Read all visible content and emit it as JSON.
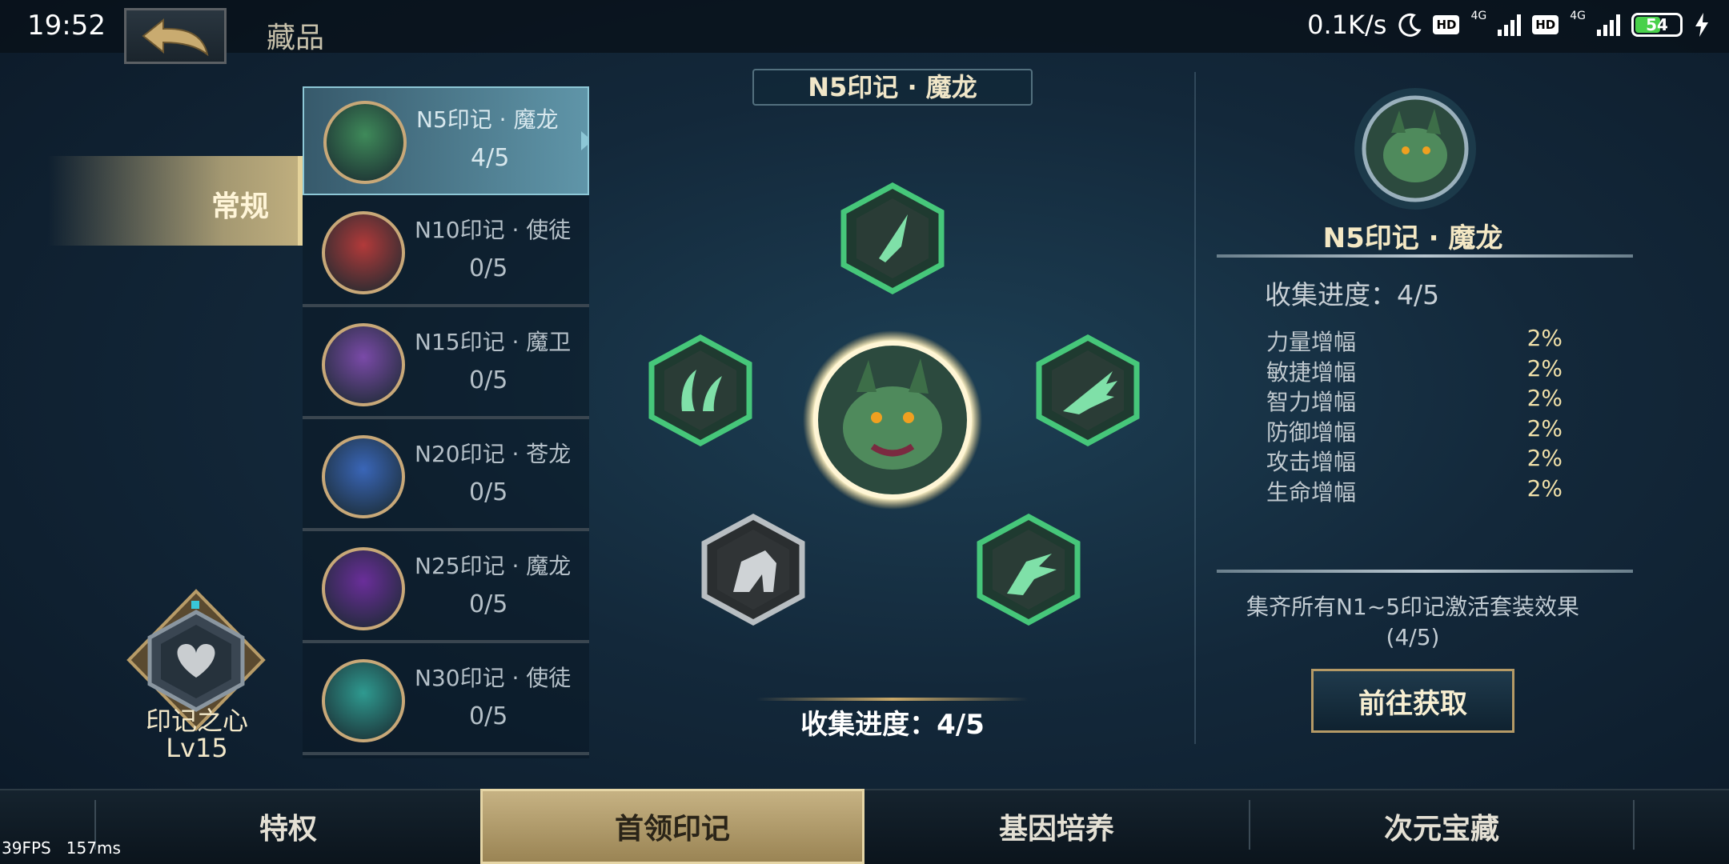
{
  "status_bar": {
    "time": "19:52",
    "net_speed": "0.1K/s",
    "network_1": "4G",
    "network_2": "4G",
    "hd_label": "HD",
    "battery": "54"
  },
  "header": {
    "title": "藏品"
  },
  "category": {
    "label": "常规"
  },
  "heart": {
    "label": "印记之心",
    "level": "Lv15"
  },
  "list": [
    {
      "name": "N5印记 · 魔龙",
      "progress": "4/5",
      "color": "#3f8a5a"
    },
    {
      "name": "N10印记 · 使徒",
      "progress": "0/5",
      "color": "#b23a3a"
    },
    {
      "name": "N15印记 · 魔卫",
      "progress": "0/5",
      "color": "#7a4aa8"
    },
    {
      "name": "N20印记 · 苍龙",
      "progress": "0/5",
      "color": "#3a66b8"
    },
    {
      "name": "N25印记 · 魔龙",
      "progress": "0/5",
      "color": "#6a2e9a"
    },
    {
      "name": "N30印记 · 使徒",
      "progress": "0/5",
      "color": "#2f9a90"
    }
  ],
  "center": {
    "title": "N5印记 · 魔龙",
    "progress_label": "收集进度：4/5"
  },
  "detail": {
    "name": "N5印记 · 魔龙",
    "progress_label": "收集进度：4/5",
    "stats": [
      {
        "name": "力量增幅",
        "value": "2%"
      },
      {
        "name": "敏捷增幅",
        "value": "2%"
      },
      {
        "name": "智力增幅",
        "value": "2%"
      },
      {
        "name": "防御增幅",
        "value": "2%"
      },
      {
        "name": "攻击增幅",
        "value": "2%"
      },
      {
        "name": "生命增幅",
        "value": "2%"
      }
    ],
    "set_line1": "集齐所有N1~5印记激活套装效果",
    "set_line2": "(4/5)",
    "get_button": "前往获取"
  },
  "tabs": {
    "t1": "特权",
    "t2": "首领印记",
    "t3": "基因培养",
    "t4": "次元宝藏"
  },
  "debug": {
    "fps": "39FPS",
    "ms": "157ms"
  },
  "colors": {
    "accent_gold": "#c6b283",
    "collected_green": "#3fbf6f",
    "locked_gray": "#9aa0a4"
  }
}
